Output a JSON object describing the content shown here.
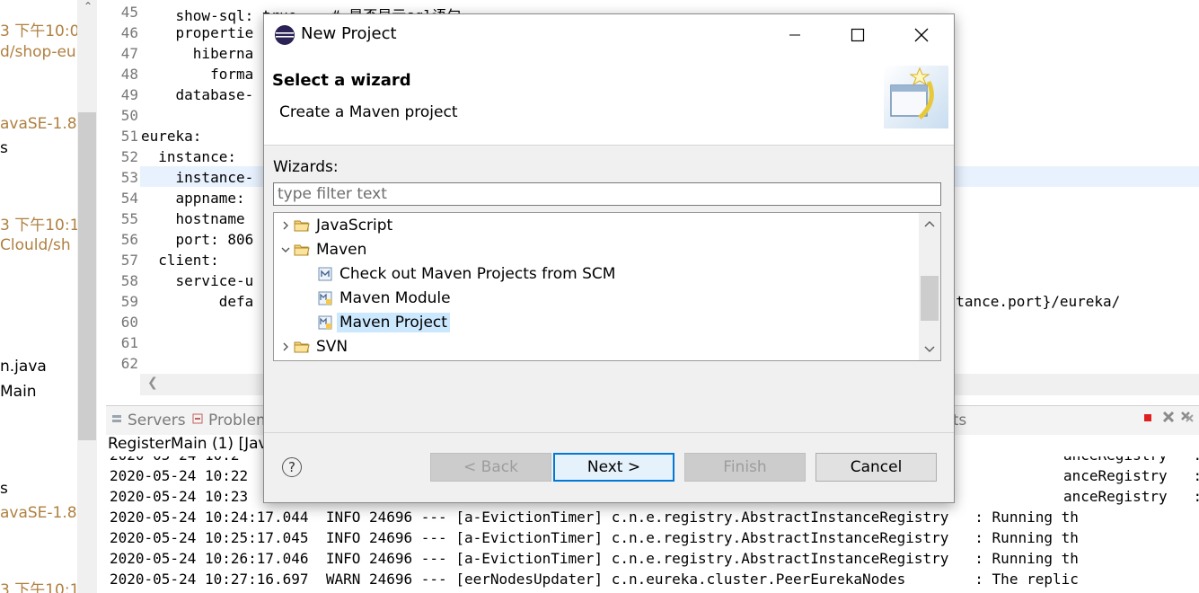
{
  "left_panel": {
    "items": [
      "3 下午10:0",
      "d/shop-eu",
      "avaSE-1.8]",
      "s",
      "3 下午10:1",
      "Clould/sh",
      "n.java",
      "Main",
      "s",
      "avaSE-1.8]",
      "3 下午10:1"
    ]
  },
  "editor": {
    "lines": [
      {
        "num": "45",
        "code": "    show-sql: true    # 是否显示sql语句"
      },
      {
        "num": "46",
        "code": "    propertie"
      },
      {
        "num": "47",
        "code": "      hiberna"
      },
      {
        "num": "48",
        "code": "        forma"
      },
      {
        "num": "49",
        "code": "    database-"
      },
      {
        "num": "50",
        "code": ""
      },
      {
        "num": "51",
        "code": "eureka:"
      },
      {
        "num": "52",
        "code": "  instance:"
      },
      {
        "num": "53",
        "code": "    instance-"
      },
      {
        "num": "54",
        "code": "    appname:"
      },
      {
        "num": "55",
        "code": "    hostname"
      },
      {
        "num": "56",
        "code": "    port: 806"
      },
      {
        "num": "57",
        "code": "  client:"
      },
      {
        "num": "58",
        "code": "    service-u"
      },
      {
        "num": "59",
        "code": "         defa"
      },
      {
        "num": "60",
        "code": ""
      },
      {
        "num": "61",
        "code": ""
      },
      {
        "num": "62",
        "code": ""
      }
    ],
    "line59_tail": "nstance.port}/eureka/"
  },
  "views": {
    "servers": "Servers",
    "problems": "Problem",
    "results": "lts"
  },
  "console": {
    "title": "RegisterMain (1) [Jav",
    "partial_top": "2020-05-24 10:2",
    "rows": [
      {
        "left": "2020-05-24 10:22",
        "right": "anceRegistry   : Registered"
      },
      {
        "left": "2020-05-24 10:23",
        "right": "anceRegistry   : Running th"
      },
      {
        "left": "2020-05-24 10:24:17.044  INFO 24696 --- [a-EvictionTimer] c.n.e.registry.AbstractInstanceRegistry   : Running th",
        "right": ""
      },
      {
        "left": "2020-05-24 10:25:17.045  INFO 24696 --- [a-EvictionTimer] c.n.e.registry.AbstractInstanceRegistry   : Running th",
        "right": ""
      },
      {
        "left": "2020-05-24 10:26:17.046  INFO 24696 --- [a-EvictionTimer] c.n.e.registry.AbstractInstanceRegistry   : Running th",
        "right": ""
      },
      {
        "left": "2020-05-24 10:27:16.697  WARN 24696 --- [eerNodesUpdater] c.n.eureka.cluster.PeerEurekaNodes        : The replic",
        "right": ""
      }
    ],
    "top_right": "anceRegistry   : Running th"
  },
  "dialog": {
    "title": "New Project",
    "header_title": "Select a wizard",
    "header_subtitle": "Create a Maven project",
    "wizards_label": "Wizards:",
    "filter_placeholder": "type filter text",
    "tree": [
      {
        "label": "JavaScript",
        "level": 0,
        "expanded": false,
        "icon": "folder-icon"
      },
      {
        "label": "Maven",
        "level": 0,
        "expanded": true,
        "icon": "folder-icon"
      },
      {
        "label": "Check out Maven Projects from SCM",
        "level": 1,
        "icon": "maven-scm-icon"
      },
      {
        "label": "Maven Module",
        "level": 1,
        "icon": "maven-module-icon"
      },
      {
        "label": "Maven Project",
        "level": 1,
        "icon": "maven-project-icon",
        "selected": true
      },
      {
        "label": "SVN",
        "level": 0,
        "expanded": false,
        "icon": "folder-icon"
      }
    ],
    "buttons": {
      "back": "< Back",
      "next": "Next >",
      "finish": "Finish",
      "cancel": "Cancel",
      "help": "?"
    }
  }
}
